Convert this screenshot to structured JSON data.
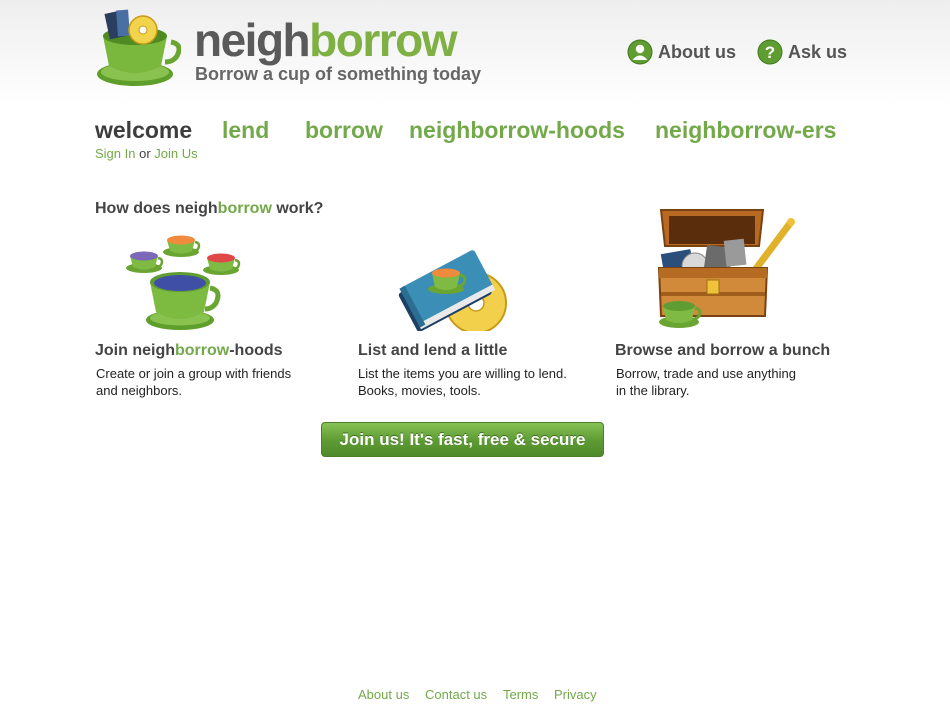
{
  "header": {
    "brand_part1": "neigh",
    "brand_part2": "borrow",
    "tagline": "Borrow a cup of something today",
    "about_label": "About us",
    "ask_label": "Ask us"
  },
  "nav": {
    "items": [
      "welcome",
      "lend",
      "borrow",
      "neighborrow-hoods",
      "neighborrow-ers"
    ],
    "sign_in": "Sign In",
    "or": "or",
    "join_us": "Join Us"
  },
  "main": {
    "how_prefix": "How does neigh",
    "how_green": "borrow",
    "how_suffix": " work?",
    "steps": [
      {
        "title_prefix": "Join neigh",
        "title_green": "borrow",
        "title_suffix": "-hoods",
        "description": "Create or join a group with friends\nand neighbors."
      },
      {
        "title": "List and lend a little",
        "description": "List the items you are willing to lend.\nBooks, movies, tools."
      },
      {
        "title": "Browse and borrow a bunch",
        "description": "Borrow, trade and use anything\nin the library."
      }
    ],
    "cta_label": "Join us! It's fast, free & secure"
  },
  "footer": {
    "links": [
      "About us",
      "Contact us",
      "Terms",
      "Privacy"
    ]
  },
  "colors": {
    "accent_green": "#73a94a",
    "text_dark": "#444444",
    "button_green": "#5d9a33"
  },
  "icons": [
    "logo-cup-icon",
    "about-person-icon",
    "question-icon",
    "teacups-illustration",
    "book-disc-illustration",
    "treasure-chest-illustration"
  ]
}
